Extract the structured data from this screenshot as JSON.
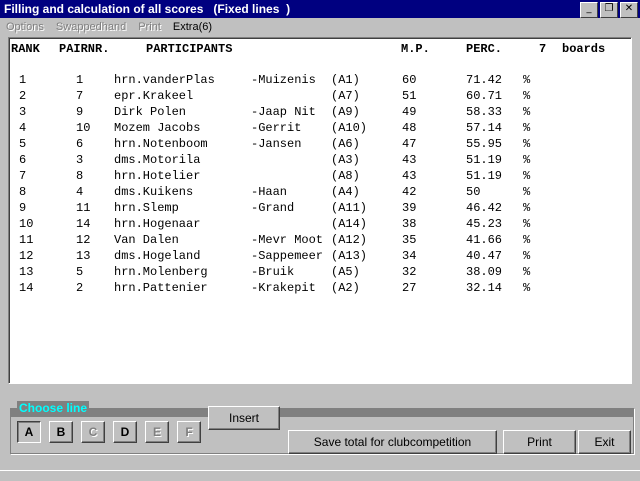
{
  "window": {
    "title": "Filling and calculation of all scores   (Fixed lines  )",
    "minimize_glyph": "_",
    "restore_glyph": "❐",
    "close_glyph": "✕"
  },
  "menu": [
    {
      "label": "Options",
      "enabled": false
    },
    {
      "label": "Swappedhand",
      "enabled": false
    },
    {
      "label": "Print",
      "enabled": false
    },
    {
      "label": "Extra(6)",
      "enabled": true
    }
  ],
  "table": {
    "headers": {
      "rank": "RANK",
      "pairnr": "PAIRNR.",
      "participants": "PARTICIPANTS",
      "mp": "M.P.",
      "perc": "PERC.",
      "boards_count": "7",
      "boards": "boards"
    },
    "rows": [
      {
        "rank": "1",
        "pair": "1",
        "p1": "hrn.vanderPlas",
        "p2": "-Muizenis",
        "code": "(A1)",
        "mp": "60",
        "perc": "71.42",
        "pct": "%"
      },
      {
        "rank": "2",
        "pair": "7",
        "p1": "epr.Krakeel",
        "p2": "",
        "code": "(A7)",
        "mp": "51",
        "perc": "60.71",
        "pct": "%"
      },
      {
        "rank": "3",
        "pair": "9",
        "p1": "Dirk Polen",
        "p2": "-Jaap Nit",
        "code": "(A9)",
        "mp": "49",
        "perc": "58.33",
        "pct": "%"
      },
      {
        "rank": "4",
        "pair": "10",
        "p1": "Mozem Jacobs",
        "p2": "-Gerrit",
        "code": "(A10)",
        "mp": "48",
        "perc": "57.14",
        "pct": "%"
      },
      {
        "rank": "5",
        "pair": "6",
        "p1": "hrn.Notenboom",
        "p2": "-Jansen",
        "code": "(A6)",
        "mp": "47",
        "perc": "55.95",
        "pct": "%"
      },
      {
        "rank": "6",
        "pair": "3",
        "p1": "dms.Motorila",
        "p2": "",
        "code": "(A3)",
        "mp": "43",
        "perc": "51.19",
        "pct": "%"
      },
      {
        "rank": "7",
        "pair": "8",
        "p1": "hrn.Hotelier",
        "p2": "",
        "code": "(A8)",
        "mp": "43",
        "perc": "51.19",
        "pct": "%"
      },
      {
        "rank": "8",
        "pair": "4",
        "p1": "dms.Kuikens",
        "p2": "-Haan",
        "code": "(A4)",
        "mp": "42",
        "perc": "50",
        "pct": "%"
      },
      {
        "rank": "9",
        "pair": "11",
        "p1": "hrn.Slemp",
        "p2": "-Grand",
        "code": "(A11)",
        "mp": "39",
        "perc": "46.42",
        "pct": "%"
      },
      {
        "rank": "10",
        "pair": "14",
        "p1": "hrn.Hogenaar",
        "p2": "",
        "code": "(A14)",
        "mp": "38",
        "perc": "45.23",
        "pct": "%"
      },
      {
        "rank": "11",
        "pair": "12",
        "p1": "Van Dalen",
        "p2": "-Mevr Moot",
        "code": "(A12)",
        "mp": "35",
        "perc": "41.66",
        "pct": "%"
      },
      {
        "rank": "12",
        "pair": "13",
        "p1": "dms.Hogeland",
        "p2": "-Sappemeer",
        "code": "(A13)",
        "mp": "34",
        "perc": "40.47",
        "pct": "%"
      },
      {
        "rank": "13",
        "pair": "5",
        "p1": "hrn.Molenberg",
        "p2": "-Bruik",
        "code": "(A5)",
        "mp": "32",
        "perc": "38.09",
        "pct": "%"
      },
      {
        "rank": "14",
        "pair": "2",
        "p1": "hrn.Pattenier",
        "p2": "-Krakepit",
        "code": "(A2)",
        "mp": "27",
        "perc": "32.14",
        "pct": "%"
      }
    ]
  },
  "choose_line": {
    "label": "Choose line",
    "buttons": [
      {
        "label": "A",
        "enabled": true,
        "pressed": true
      },
      {
        "label": "B",
        "enabled": true,
        "pressed": false
      },
      {
        "label": "C",
        "enabled": false,
        "pressed": false
      },
      {
        "label": "D",
        "enabled": true,
        "pressed": false
      },
      {
        "label": "E",
        "enabled": false,
        "pressed": false
      },
      {
        "label": "F",
        "enabled": false,
        "pressed": false
      }
    ]
  },
  "buttons": {
    "insert": "Insert",
    "save_total": "Save total for clubcompetition",
    "print": "Print",
    "exit": "Exit"
  }
}
